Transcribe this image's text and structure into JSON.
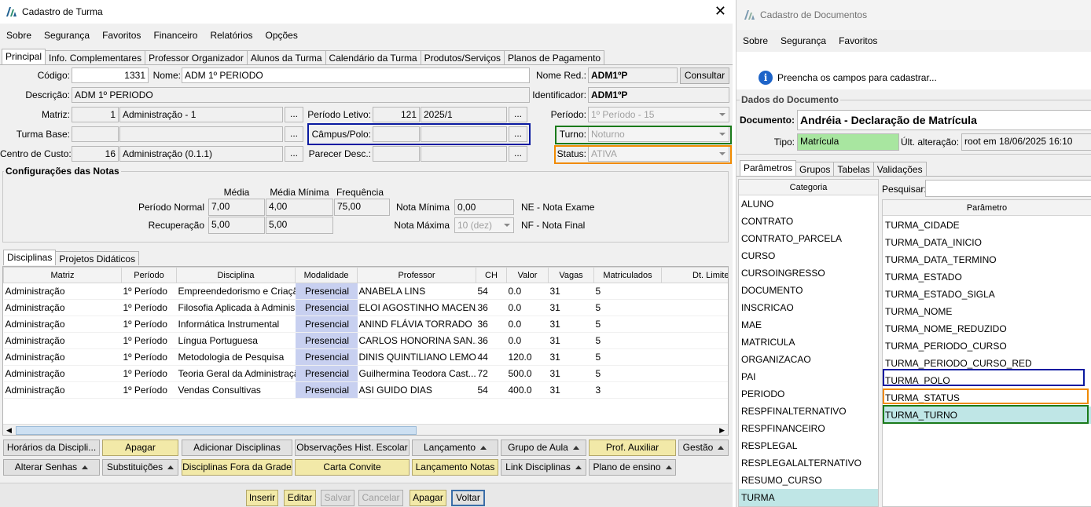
{
  "turma": {
    "title": "Cadastro de Turma",
    "menu": [
      "Sobre",
      "Segurança",
      "Favoritos",
      "Financeiro",
      "Relatórios",
      "Opções"
    ],
    "tabs": [
      "Principal",
      "Info. Complementares",
      "Professor Organizador",
      "Alunos da Turma",
      "Calendário da Turma",
      "Produtos/Serviços",
      "Planos de Pagamento"
    ],
    "labels": {
      "codigo": "Código:",
      "nome": "Nome:",
      "nome_red": "Nome Red.:",
      "descricao": "Descrição:",
      "identificador": "Identificador:",
      "matriz": "Matriz:",
      "periodo_letivo": "Período Letivo:",
      "periodo": "Período:",
      "turma_base": "Turma Base:",
      "campus_polo": "Câmpus/Polo:",
      "turno": "Turno:",
      "centro_custo": "Centro de Custo:",
      "parecer_desc": "Parecer Desc.:",
      "status": "Status:"
    },
    "values": {
      "codigo": "1331",
      "nome": "ADM 1º PERIODO",
      "nome_red": "ADM1ºP",
      "descricao": "ADM 1º PERIODO",
      "identificador": "ADM1ºP",
      "matriz_id": "1",
      "matriz_nome": "Administração - 1",
      "periodo_letivo_id": "121",
      "periodo_letivo": "2025/1",
      "periodo": "1º Período - 15",
      "turno": "Noturno",
      "centro_custo_id": "16",
      "centro_custo": "Administração (0.1.1)",
      "status": "ATIVA"
    },
    "consultar": "Consultar",
    "dots": "...",
    "notas": {
      "title": "Configurações das Notas",
      "col_media": "Média",
      "col_media_min": "Média Mínima",
      "col_freq": "Frequência",
      "periodo_normal": "Período Normal",
      "recuperacao": "Recuperação",
      "pn_media": "7,00",
      "pn_media_min": "4,00",
      "pn_freq": "75,00",
      "rec_media": "5,00",
      "rec_media_min": "5,00",
      "nota_minima_lbl": "Nota Mínima",
      "nota_minima": "0,00",
      "nota_maxima_lbl": "Nota Máxima",
      "nota_maxima": "10 (dez)",
      "ne": "NE - Nota Exame",
      "nf": "NF - Nota Final"
    },
    "subtabs": [
      "Disciplinas",
      "Projetos Didáticos"
    ],
    "grid": {
      "headers": [
        "Matriz",
        "Período",
        "Disciplina",
        "Modalidade",
        "Professor",
        "CH",
        "Valor",
        "Vagas",
        "Matriculados",
        "Dt. Limite Ma..."
      ],
      "rows": [
        [
          "Administração",
          "1º Período",
          "Empreendedorismo e Criaçã",
          "Presencial",
          "ANABELA LINS",
          "54",
          "0.0",
          "31",
          "5"
        ],
        [
          "Administração",
          "1º Período",
          "Filosofia Aplicada à Adminis",
          "Presencial",
          "ELOI AGOSTINHO MACENA",
          "36",
          "0.0",
          "31",
          "5"
        ],
        [
          "Administração",
          "1º Período",
          "Informática Instrumental",
          "Presencial",
          "ANIND FLÁVIA TORRADO",
          "36",
          "0.0",
          "31",
          "5"
        ],
        [
          "Administração",
          "1º Período",
          "Língua Portuguesa",
          "Presencial",
          "CARLOS HONORINA SAN...",
          "36",
          "0.0",
          "31",
          "5"
        ],
        [
          "Administração",
          "1º Período",
          "Metodologia de Pesquisa",
          "Presencial",
          "DINIS QUINTILIANO LEMOS",
          "44",
          "120.0",
          "31",
          "5"
        ],
        [
          "Administração",
          "1º Período",
          "Teoria Geral da Administraçã",
          "Presencial",
          "Guilhermina Teodora Cast...",
          "72",
          "500.0",
          "31",
          "5"
        ],
        [
          "Administração",
          "1º Período",
          "Vendas Consultivas",
          "Presencial",
          "ASI GUIDO DIAS",
          "54",
          "400.0",
          "31",
          "3"
        ]
      ]
    },
    "actions_row1": [
      "Horários da Discipli...",
      "Apagar",
      "Adicionar Disciplinas",
      "Observações Hist. Escolar",
      "Lançamento",
      "Grupo de Aula",
      "Prof. Auxiliar",
      "Gestão"
    ],
    "actions_row2": [
      "Alterar Senhas",
      "Substituições",
      "Disciplinas Fora da Grade",
      "Carta Convite",
      "Lançamento Notas",
      "Link Disciplinas",
      "Plano de ensino"
    ],
    "footer": [
      "Inserir",
      "Editar",
      "Salvar",
      "Cancelar",
      "Apagar",
      "Voltar"
    ]
  },
  "documentos": {
    "title": "Cadastro de Documentos",
    "menu": [
      "Sobre",
      "Segurança",
      "Favoritos"
    ],
    "info": "Preencha os campos para cadastrar...",
    "section": "Dados do Documento",
    "documento_lbl": "Documento:",
    "documento": "Andréia - Declaração de Matrícula",
    "tipo_lbl": "Tipo:",
    "tipo": "Matrícula",
    "ult_alt_lbl": "Últ. alteração:",
    "ult_alt": "root em 18/06/2025 16:10",
    "tabs": [
      "Parâmetros",
      "Grupos",
      "Tabelas",
      "Validações"
    ],
    "categoria_header": "Categoria",
    "categorias": [
      "ALUNO",
      "CONTRATO",
      "CONTRATO_PARCELA",
      "CURSO",
      "CURSOINGRESSO",
      "DOCUMENTO",
      "INSCRICAO",
      "MAE",
      "MATRICULA",
      "ORGANIZACAO",
      "PAI",
      "PERIODO",
      "RESPFINALTERNATIVO",
      "RESPFINANCEIRO",
      "RESPLEGAL",
      "RESPLEGALALTERNATIVO",
      "RESUMO_CURSO",
      "TURMA"
    ],
    "pesquisar_lbl": "Pesquisar:",
    "parametro_header": "Parâmetro",
    "parametros": [
      "TURMA_CIDADE",
      "TURMA_DATA_INICIO",
      "TURMA_DATA_TERMINO",
      "TURMA_ESTADO",
      "TURMA_ESTADO_SIGLA",
      "TURMA_NOME",
      "TURMA_NOME_REDUZIDO",
      "TURMA_PERIODO_CURSO",
      "TURMA_PERIODO_CURSO_RED",
      "TURMA_POLO",
      "TURMA_STATUS",
      "TURMA_TURNO"
    ]
  },
  "colors": {
    "highlight_blue": "#0a1aa0",
    "highlight_green": "#1a7a1a",
    "highlight_orange": "#f08a00",
    "selection_teal": "#bfe6e6",
    "tipo_green": "#a8e6a0",
    "presencial": "#c8d0f0",
    "gold_button": "#f2e9a8"
  }
}
